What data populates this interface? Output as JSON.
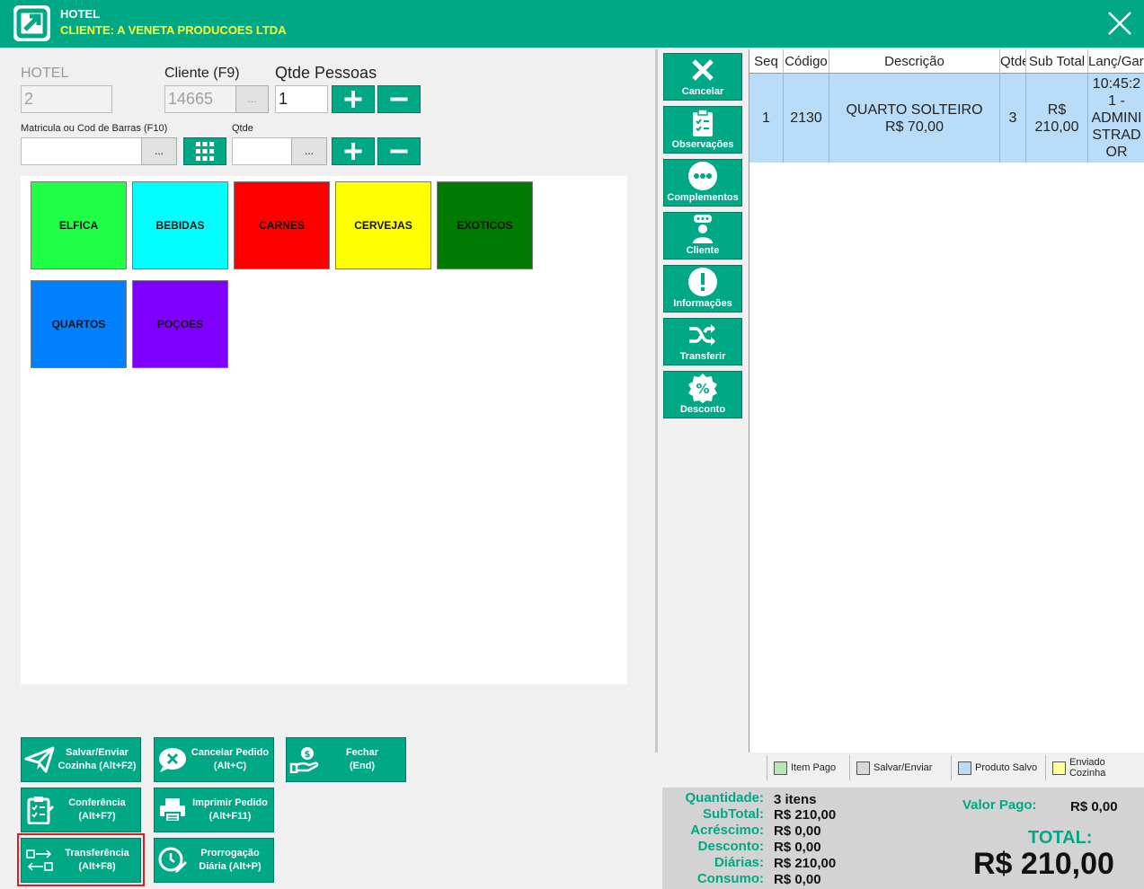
{
  "window": {
    "title": "HOTEL",
    "client_line": "CLIENTE: A VENETA PRODUCOES LTDA"
  },
  "form": {
    "hotel_label": "HOTEL",
    "hotel_value": "2",
    "cliente_label": "Cliente (F9)",
    "cliente_value": "14665",
    "dots": "...",
    "pessoas_label": "Qtde Pessoas",
    "pessoas_value": "1",
    "matricula_label": "Matricula ou Cod de Barras (F10)",
    "matricula_value": "",
    "qtde_label": "Qtde",
    "qtde_value": ""
  },
  "categories": [
    {
      "label": "ELFICA",
      "color": "#1eff46"
    },
    {
      "label": "BEBIDAS",
      "color": "#00ffff"
    },
    {
      "label": "CARNES",
      "color": "#ff0000"
    },
    {
      "label": "CERVEJAS",
      "color": "#ffff00"
    },
    {
      "label": "EXOTICOS",
      "color": "#007a00"
    },
    {
      "label": "QUARTOS",
      "color": "#0080ff"
    },
    {
      "label": "POÇOES",
      "color": "#8000ff"
    }
  ],
  "actions": {
    "salvar": "Salvar/Enviar\nCozinha (Alt+F2)",
    "cancelar_pedido": "Cancelar Pedido\n(Alt+C)",
    "fechar": "Fechar\n(End)",
    "conferencia": "Conferência\n(Alt+F7)",
    "imprimir": "Imprimir Pedido\n(Alt+F11)",
    "transferencia": "Transferência\n(Alt+F8)",
    "prorrogacao": "Prorrogação\nDiária (Alt+P)"
  },
  "sidebar": {
    "cancelar": "Cancelar",
    "observacoes": "Observações",
    "complementos": "Complementos",
    "cliente": "Cliente",
    "informacoes": "Informações",
    "transferir": "Transferir",
    "desconto": "Desconto"
  },
  "grid": {
    "headers": [
      "Seq",
      "Código",
      "Descrição",
      "Qtde",
      "Sub Total",
      "Lanç/Garç"
    ],
    "rows": [
      {
        "seq": "1",
        "codigo": "2130",
        "descricao": "QUARTO SOLTEIRO\nR$ 70,00",
        "qtde": "3",
        "subtotal": "R$\n210,00",
        "lanc": "10:45:2\n1 -\nADMINI\nSTRAD\nOR"
      }
    ]
  },
  "legend": [
    {
      "label": "Item Pago",
      "color": "#b8e6b8"
    },
    {
      "label": "Salvar/Enviar",
      "color": "#d8d8d8"
    },
    {
      "label": "Produto Salvo",
      "color": "#b9dcf8"
    },
    {
      "label": "Enviado Cozinha",
      "color": "#ffff99"
    }
  ],
  "totals": {
    "quantidade_label": "Quantidade:",
    "quantidade_value": "3 itens",
    "subtotal_label": "SubTotal:",
    "subtotal_value": "R$ 210,00",
    "acrescimo_label": "Acréscimo:",
    "acrescimo_value": "R$ 0,00",
    "desconto_label": "Desconto:",
    "desconto_value": "R$ 0,00",
    "diarias_label": "Diárias:",
    "diarias_value": "R$ 210,00",
    "consumo_label": "Consumo:",
    "consumo_value": "R$ 0,00",
    "valor_pago_label": "Valor Pago:",
    "valor_pago_value": "R$ 0,00",
    "total_label": "TOTAL:",
    "total_value": "R$ 210,00"
  }
}
